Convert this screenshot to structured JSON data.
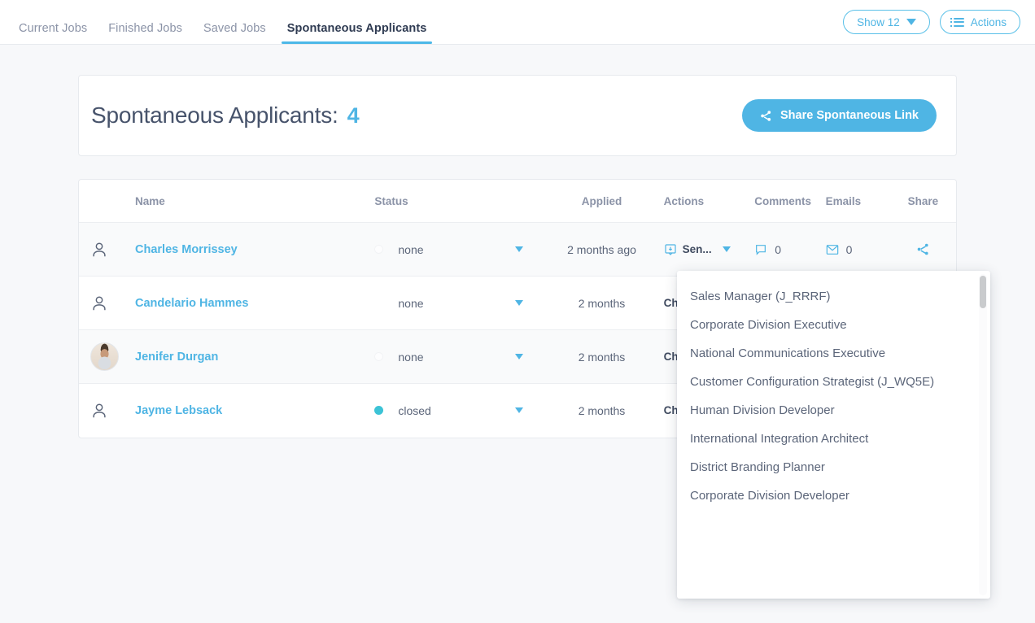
{
  "tabs": [
    {
      "label": "Current Jobs",
      "active": false
    },
    {
      "label": "Finished Jobs",
      "active": false
    },
    {
      "label": "Saved Jobs",
      "active": false
    },
    {
      "label": "Spontaneous Applicants",
      "active": true
    }
  ],
  "topbar": {
    "show_label": "Show 12",
    "actions_label": "Actions"
  },
  "header": {
    "title": "Spontaneous Applicants:",
    "count": "4",
    "share_button": "Share Spontaneous Link"
  },
  "table": {
    "columns": [
      "Name",
      "Status",
      "Applied",
      "Actions",
      "Comments",
      "Emails",
      "Share"
    ],
    "rows": [
      {
        "name": "Charles Morrissey",
        "avatar": "person-icon",
        "status": "none",
        "status_dot": "#fdfdfe",
        "applied": "2 months ago",
        "action": "Sen...",
        "comments": "0",
        "emails": "0"
      },
      {
        "name": "Candelario Hammes",
        "avatar": "person-icon",
        "status": "none",
        "status_dot": "none",
        "applied": "2 months",
        "action": "Ch",
        "comments": "",
        "emails": ""
      },
      {
        "name": "Jenifer Durgan",
        "avatar": "photo",
        "status": "none",
        "status_dot": "#fdfdfe",
        "applied": "2 months",
        "action": "Ch",
        "comments": "",
        "emails": ""
      },
      {
        "name": "Jayme Lebsack",
        "avatar": "person-icon",
        "status": "closed",
        "status_dot": "#3cc3d6",
        "applied": "2 months",
        "action": "Ch",
        "comments": "",
        "emails": ""
      }
    ]
  },
  "dropdown": {
    "items": [
      "Sales Manager (J_RRRF)",
      "Corporate Division Executive",
      "National Communications Executive",
      "Customer Configuration Strategist (J_WQ5E)",
      "Human Division Developer",
      "International Integration Architect",
      "District Branding Planner",
      "Corporate Division Developer"
    ]
  },
  "colors": {
    "accent": "#4fb5e4",
    "text_dark": "#47536b",
    "text_muted": "#8b93a7",
    "status_closed": "#3cc3d6",
    "page_bg": "#f7f8fa"
  }
}
